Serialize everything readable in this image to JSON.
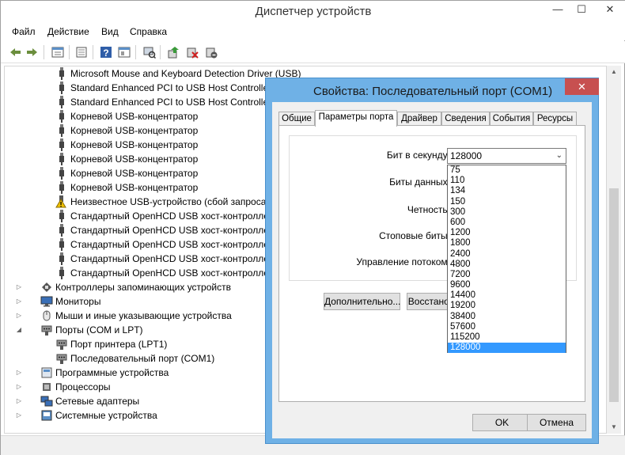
{
  "main_window": {
    "title": "Диспетчер устройств",
    "controls": {
      "minimize": "—",
      "maximize": "☐",
      "close": "✕"
    }
  },
  "menu": [
    "Файл",
    "Действие",
    "Вид",
    "Справка"
  ],
  "toolbar": {
    "icons": [
      "back-icon",
      "forward-icon",
      "properties-icon",
      "view-icon",
      "help-icon",
      "resources-icon",
      "scan-hardware-icon",
      "update-driver-icon",
      "uninstall-icon",
      "disable-icon"
    ]
  },
  "tree": {
    "usb_children": [
      {
        "label": "Microsoft Mouse and Keyboard Detection Driver (USB)",
        "icon": "usb-icon"
      },
      {
        "label": "Standard Enhanced PCI to USB Host Controller",
        "icon": "usb-icon"
      },
      {
        "label": "Standard Enhanced PCI to USB Host Controller",
        "icon": "usb-icon"
      },
      {
        "label": "Корневой USB-концентратор",
        "icon": "usb-icon"
      },
      {
        "label": "Корневой USB-концентратор",
        "icon": "usb-icon"
      },
      {
        "label": "Корневой USB-концентратор",
        "icon": "usb-icon"
      },
      {
        "label": "Корневой USB-концентратор",
        "icon": "usb-icon"
      },
      {
        "label": "Корневой USB-концентратор",
        "icon": "usb-icon"
      },
      {
        "label": "Корневой USB-концентратор",
        "icon": "usb-icon"
      },
      {
        "label": "Неизвестное USB-устройство (сбой запроса д",
        "icon": "warning-icon"
      },
      {
        "label": "Стандартный OpenHCD USB хост-контроллер",
        "icon": "usb-icon"
      },
      {
        "label": "Стандартный OpenHCD USB хост-контроллер",
        "icon": "usb-icon"
      },
      {
        "label": "Стандартный OpenHCD USB хост-контроллер",
        "icon": "usb-icon"
      },
      {
        "label": "Стандартный OpenHCD USB хост-контроллер",
        "icon": "usb-icon"
      },
      {
        "label": "Стандартный OpenHCD USB хост-контроллер",
        "icon": "usb-icon"
      }
    ],
    "categories": [
      {
        "label": "Контроллеры запоминающих устройств",
        "expander": "▷",
        "icon": "storage-icon"
      },
      {
        "label": "Мониторы",
        "expander": "▷",
        "icon": "monitor-icon"
      },
      {
        "label": "Мыши и иные указывающие устройства",
        "expander": "▷",
        "icon": "mouse-icon"
      },
      {
        "label": "Порты (COM и LPT)",
        "expander": "◢",
        "icon": "port-icon"
      }
    ],
    "port_children": [
      {
        "label": "Порт принтера (LPT1)",
        "icon": "port-icon"
      },
      {
        "label": "Последовательный порт (COM1)",
        "icon": "port-icon"
      }
    ],
    "categories_after": [
      {
        "label": "Программные устройства",
        "expander": "▷",
        "icon": "software-icon"
      },
      {
        "label": "Процессоры",
        "expander": "▷",
        "icon": "cpu-icon"
      },
      {
        "label": "Сетевые адаптеры",
        "expander": "▷",
        "icon": "network-icon"
      },
      {
        "label": "Системные устройства",
        "expander": "▷",
        "icon": "system-icon"
      }
    ]
  },
  "dialog": {
    "title": "Свойства: Последовательный порт (COM1)",
    "close": "✕",
    "tabs": [
      "Общие",
      "Параметры порта",
      "Драйвер",
      "Сведения",
      "События",
      "Ресурсы"
    ],
    "active_tab": 1,
    "fields": {
      "baud_label": "Бит в секунду:",
      "baud_value": "128000",
      "data_bits_label": "Биты данных:",
      "parity_label": "Четность:",
      "stop_bits_label": "Стоповые биты:",
      "flow_control_label": "Управление потоком:"
    },
    "buttons": {
      "advanced": "Дополнительно...",
      "restore": "Восстанов",
      "ok": "OK",
      "cancel": "Отмена"
    },
    "baud_options": [
      "75",
      "110",
      "134",
      "150",
      "300",
      "600",
      "1200",
      "1800",
      "2400",
      "4800",
      "7200",
      "9600",
      "14400",
      "19200",
      "38400",
      "57600",
      "115200",
      "128000"
    ],
    "baud_selected_index": 17
  },
  "colors": {
    "dialog_frame": "#6fb1e6",
    "close_button": "#c75050",
    "selection": "#3399ff"
  }
}
